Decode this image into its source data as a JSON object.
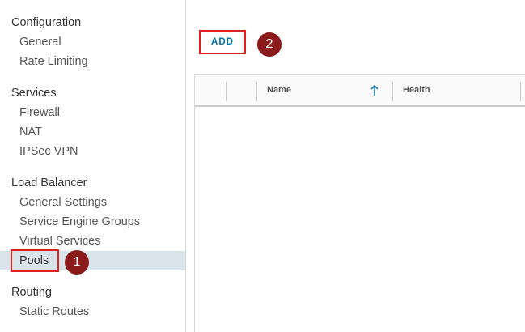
{
  "sidebar": {
    "sections": [
      {
        "title": "Configuration",
        "items": [
          "General",
          "Rate Limiting"
        ]
      },
      {
        "title": "Services",
        "items": [
          "Firewall",
          "NAT",
          "IPSec VPN"
        ]
      },
      {
        "title": "Load Balancer",
        "items": [
          "General Settings",
          "Service Engine Groups",
          "Virtual Services",
          "Pools"
        ]
      },
      {
        "title": "Routing",
        "items": [
          "Static Routes"
        ]
      }
    ],
    "active_item": "Pools"
  },
  "toolbar": {
    "add_label": "ADD"
  },
  "grid": {
    "columns": [
      "Name",
      "Health"
    ],
    "sort_column": "Name",
    "sort_direction": "ascending"
  },
  "callouts": [
    {
      "number": "1",
      "target": "Pools"
    },
    {
      "number": "2",
      "target": "ADD"
    }
  ],
  "colors": {
    "accent": "#0072a3",
    "active_bg": "#d9e4ea",
    "callout_border": "#e02020",
    "badge_bg": "#8b1a1a"
  }
}
